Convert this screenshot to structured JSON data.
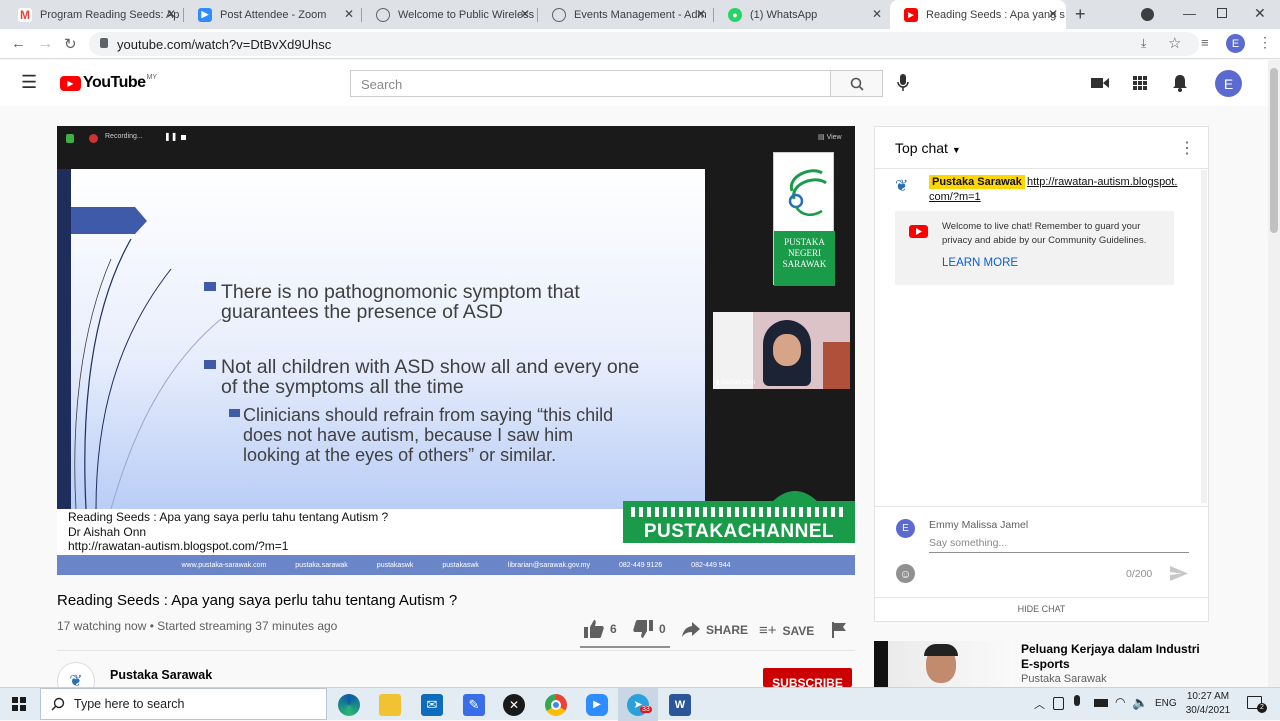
{
  "browser": {
    "tabs": [
      {
        "title": "Program Reading Seeds: Ap",
        "icon": "gmail-icon",
        "color": "#ea4335"
      },
      {
        "title": "Post Attendee - Zoom",
        "icon": "zoom-icon",
        "color": "#2d8cff"
      },
      {
        "title": "Welcome to Public Wireless",
        "icon": "globe-icon",
        "color": "#5f6368"
      },
      {
        "title": "Events Management - Adm",
        "icon": "globe-icon",
        "color": "#5f6368"
      },
      {
        "title": "(1) WhatsApp",
        "icon": "whatsapp-icon",
        "color": "#25d366"
      },
      {
        "title": "Reading Seeds : Apa yang s",
        "icon": "youtube-icon",
        "color": "#ff0000"
      }
    ],
    "url": "youtube.com/watch?v=DtBvXd9Uhsc",
    "profile_letter": "E"
  },
  "youtube": {
    "logo_text": "YouTube",
    "region": "MY",
    "search_placeholder": "Search",
    "avatar_letter": "E"
  },
  "video": {
    "recording_label": "Recording...",
    "view_label": "View",
    "participant_name": "Aishah Onn",
    "slide_bullets": [
      "There is no pathognomonic symptom that\nguarantees the presence of ASD",
      "Not all children with ASD show all and every one\nof the symptoms all the time"
    ],
    "slide_sub_bullet": "Clinicians should refrain from saying “this child\ndoes not have autism, because I saw him\nlooking at the eyes of others” or similar.",
    "logo_text": "PUSTAKA\nNEGERI\nSARAWAK",
    "lower_third": {
      "line1": "Reading Seeds : Apa yang saya perlu tahu tentang Autism ?",
      "line2": "Dr Aishah Onn",
      "line3": "http://rawatan-autism.blogspot.com/?m=1"
    },
    "channel_brand": "PUSTAKACHANNEL",
    "footer_items": [
      "www.pustaka-sarawak.com",
      "pustaka.sarawak",
      "pustakaswk",
      "pustakaswk",
      "librarian@sarawak.gov.my",
      "082-449 9126",
      "082-449 944"
    ]
  },
  "meta": {
    "title": "Reading Seeds : Apa yang saya perlu tahu tentang Autism ?",
    "stats": "17 watching now • Started streaming 37 minutes ago",
    "likes": "6",
    "dislikes": "0",
    "share_label": "SHARE",
    "save_label": "SAVE",
    "channel_name": "Pustaka Sarawak",
    "subscribe_label": "SUBSCRIBE"
  },
  "chat": {
    "header": "Top chat",
    "messages": [
      {
        "author": "Pustaka Sarawak",
        "text": "http://rawatan-autism.blogspot.com/?m=1"
      }
    ],
    "welcome_text": "Welcome to live chat! Remember to guard your privacy and abide by our Community Guidelines.",
    "learn_more": "LEARN MORE",
    "user_name": "Emmy Malissa Jamel",
    "input_placeholder": "Say something...",
    "char_count": "0/200",
    "hide_chat": "HIDE CHAT",
    "user_avatar_letter": "E"
  },
  "suggestion": {
    "title": "Peluang Kerjaya dalam Industri E-sports",
    "channel": "Pustaka Sarawak"
  },
  "taskbar": {
    "search_placeholder": "Type here to search",
    "language": "ENG",
    "time": "10:27 AM",
    "date": "30/4/2021",
    "telegram_badge": "33"
  }
}
